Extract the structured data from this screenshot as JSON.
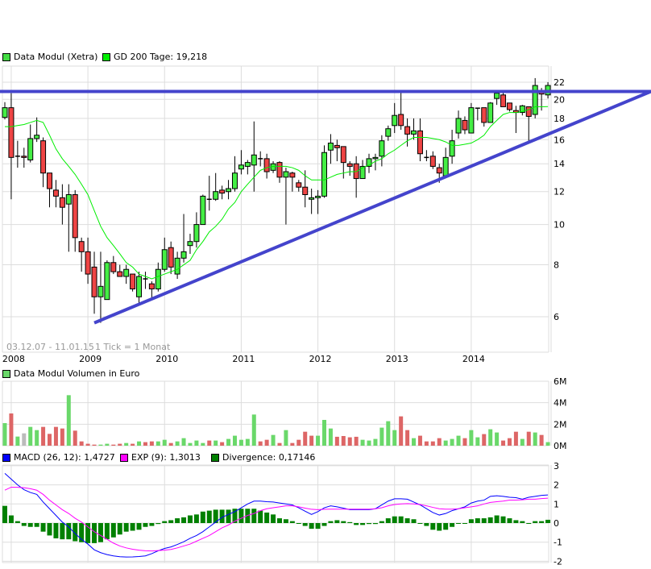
{
  "legend": {
    "price_series": "Data Modul (Xetra)",
    "ma_label": "GD 200 Tage: 19,218",
    "volume_label": "Data Modul Volumen in Euro",
    "macd_label": "MACD (26, 12): 1,4727",
    "signal_label": "EXP (9): 1,3013",
    "divergence_label": "Divergence: 0,17146"
  },
  "info": {
    "date_range": "03.12.07 - 11.01.15",
    "tick_info": "1 Tick = 1 Monat"
  },
  "colors": {
    "candle_up": "#44ee44",
    "candle_down": "#ee4444",
    "ma_line": "#00ee00",
    "trendline": "#4444cc",
    "volume_up": "#6ad86a",
    "volume_down": "#dd6666",
    "volume_flat": "#bbbbbb",
    "macd": "#0000ff",
    "signal": "#ff00ff",
    "divergence": "#008000",
    "grid": "#dddddd"
  },
  "chart_data": [
    {
      "type": "candlestick",
      "scale": "log",
      "ylim": [
        5.7,
        23
      ],
      "grid": true,
      "legend_placement": "top-left",
      "x_ticks": [
        "2008",
        "2009",
        "2010",
        "2011",
        "2012",
        "2013",
        "2014"
      ],
      "y_ticks": [
        6,
        8,
        10,
        12,
        14,
        16,
        18,
        20,
        22
      ],
      "columns": [
        "date",
        "open",
        "high",
        "low",
        "close"
      ],
      "candles": [
        [
          "2007-12",
          18.1,
          19.7,
          17.9,
          19.1
        ],
        [
          "2008-01",
          19.1,
          20.7,
          11.5,
          14.5
        ],
        [
          "2008-02",
          14.6,
          15.9,
          13.7,
          14.6
        ],
        [
          "2008-03",
          14.6,
          15.3,
          13.7,
          14.5
        ],
        [
          "2008-04",
          14.3,
          17.4,
          14.1,
          16.1
        ],
        [
          "2008-05",
          16.1,
          18.1,
          15.8,
          16.4
        ],
        [
          "2008-06",
          15.9,
          16.2,
          12.3,
          13.3
        ],
        [
          "2008-07",
          13.3,
          13.3,
          11.0,
          12.2
        ],
        [
          "2008-08",
          12.1,
          12.8,
          11.0,
          11.7
        ],
        [
          "2008-09",
          11.6,
          12.5,
          10.0,
          11.0
        ],
        [
          "2008-10",
          11.2,
          12.5,
          8.6,
          11.8
        ],
        [
          "2008-11",
          11.8,
          12.1,
          8.6,
          9.3
        ],
        [
          "2008-12",
          9.1,
          9.3,
          7.7,
          8.6
        ],
        [
          "2009-01",
          8.6,
          9.3,
          7.2,
          7.6
        ],
        [
          "2009-02",
          7.9,
          8.6,
          6.1,
          6.7
        ],
        [
          "2009-03",
          6.7,
          8.6,
          5.8,
          7.1
        ],
        [
          "2009-04",
          6.6,
          8.2,
          6.6,
          8.1
        ],
        [
          "2009-05",
          8.1,
          8.4,
          7.6,
          7.7
        ],
        [
          "2009-06",
          7.7,
          8.0,
          7.5,
          7.5
        ],
        [
          "2009-07",
          7.5,
          8.0,
          7.2,
          7.8
        ],
        [
          "2009-08",
          7.6,
          7.6,
          6.9,
          7.0
        ],
        [
          "2009-09",
          6.7,
          7.7,
          6.4,
          7.5
        ],
        [
          "2009-10",
          7.4,
          7.7,
          7.0,
          7.4
        ],
        [
          "2009-11",
          7.2,
          7.3,
          6.6,
          7.0
        ],
        [
          "2009-12",
          7.0,
          8.1,
          6.9,
          7.8
        ],
        [
          "2010-01",
          7.8,
          9.3,
          7.7,
          8.7
        ],
        [
          "2010-02",
          8.8,
          9.1,
          7.6,
          7.9
        ],
        [
          "2010-03",
          7.6,
          8.6,
          7.4,
          8.3
        ],
        [
          "2010-04",
          8.3,
          10.6,
          8.1,
          8.6
        ],
        [
          "2010-05",
          8.9,
          9.5,
          8.5,
          9.1
        ],
        [
          "2010-06",
          9.1,
          10.7,
          8.8,
          10.0
        ],
        [
          "2010-07",
          10.0,
          11.8,
          10.0,
          11.7
        ],
        [
          "2010-08",
          11.5,
          13.1,
          10.8,
          11.5
        ],
        [
          "2010-09",
          11.5,
          13.3,
          11.4,
          12.0
        ],
        [
          "2010-10",
          12.1,
          12.4,
          11.5,
          11.9
        ],
        [
          "2010-11",
          12.0,
          12.8,
          11.5,
          12.2
        ],
        [
          "2010-12",
          12.2,
          14.6,
          12.0,
          13.3
        ],
        [
          "2011-01",
          13.6,
          15.1,
          13.2,
          13.9
        ],
        [
          "2011-02",
          13.8,
          14.3,
          13.2,
          14.1
        ],
        [
          "2011-03",
          13.9,
          17.7,
          12.0,
          14.7
        ],
        [
          "2011-04",
          14.4,
          15.0,
          13.8,
          14.4
        ],
        [
          "2011-05",
          14.4,
          14.8,
          12.9,
          13.4
        ],
        [
          "2011-06",
          13.5,
          14.2,
          13.3,
          14.0
        ],
        [
          "2011-07",
          14.1,
          14.2,
          12.6,
          13.0
        ],
        [
          "2011-08",
          13.0,
          13.7,
          10.0,
          13.4
        ],
        [
          "2011-09",
          13.3,
          13.4,
          12.0,
          13.0
        ],
        [
          "2011-10",
          12.6,
          12.8,
          12.0,
          12.3
        ],
        [
          "2011-11",
          12.3,
          13.5,
          11.0,
          11.8
        ],
        [
          "2011-12",
          11.5,
          12.2,
          10.6,
          11.6
        ],
        [
          "2012-01",
          11.6,
          12.1,
          10.6,
          11.7
        ],
        [
          "2012-02",
          11.7,
          15.5,
          11.6,
          14.9
        ],
        [
          "2012-03",
          15.1,
          16.5,
          14.0,
          15.7
        ],
        [
          "2012-04",
          15.5,
          16.0,
          14.2,
          15.3
        ],
        [
          "2012-05",
          15.4,
          15.4,
          12.9,
          14.1
        ],
        [
          "2012-06",
          14.0,
          14.2,
          13.1,
          13.8
        ],
        [
          "2012-07",
          14.0,
          14.6,
          11.6,
          12.9
        ],
        [
          "2012-08",
          12.9,
          14.3,
          12.9,
          13.8
        ],
        [
          "2012-09",
          13.8,
          14.8,
          13.3,
          14.4
        ],
        [
          "2012-10",
          14.4,
          14.8,
          13.5,
          14.5
        ],
        [
          "2012-11",
          14.6,
          16.4,
          13.8,
          15.9
        ],
        [
          "2012-12",
          16.3,
          17.3,
          15.9,
          17.0
        ],
        [
          "2013-01",
          17.3,
          19.6,
          16.6,
          18.3
        ],
        [
          "2013-02",
          18.4,
          20.9,
          16.9,
          17.3
        ],
        [
          "2013-03",
          17.2,
          18.0,
          15.4,
          16.5
        ],
        [
          "2013-04",
          16.5,
          18.0,
          16.0,
          16.8
        ],
        [
          "2013-05",
          16.8,
          18.0,
          14.2,
          14.8
        ],
        [
          "2013-06",
          14.5,
          15.1,
          14.2,
          14.5
        ],
        [
          "2013-07",
          14.6,
          15.0,
          13.6,
          13.8
        ],
        [
          "2013-08",
          13.7,
          14.0,
          12.6,
          13.3
        ],
        [
          "2013-09",
          13.1,
          15.3,
          13.1,
          14.5
        ],
        [
          "2013-10",
          14.6,
          16.9,
          14.0,
          15.9
        ],
        [
          "2013-11",
          16.6,
          18.8,
          16.1,
          18.0
        ],
        [
          "2013-12",
          17.8,
          18.2,
          16.5,
          16.9
        ],
        [
          "2014-01",
          16.6,
          19.6,
          16.6,
          19.1
        ],
        [
          "2014-02",
          19.1,
          19.1,
          17.8,
          19.0
        ],
        [
          "2014-03",
          19.1,
          19.1,
          17.2,
          17.6
        ],
        [
          "2014-04",
          17.6,
          19.7,
          17.6,
          19.6
        ],
        [
          "2014-05",
          20.1,
          21.0,
          19.4,
          20.7
        ],
        [
          "2014-06",
          20.5,
          20.8,
          19.2,
          19.2
        ],
        [
          "2014-07",
          19.6,
          19.6,
          18.7,
          18.9
        ],
        [
          "2014-08",
          18.8,
          19.3,
          16.6,
          18.6
        ],
        [
          "2014-09",
          18.6,
          19.4,
          18.3,
          19.3
        ],
        [
          "2014-10",
          19.2,
          19.2,
          15.8,
          18.2
        ],
        [
          "2014-11",
          18.4,
          22.5,
          18.0,
          21.6
        ],
        [
          "2014-12",
          20.9,
          21.3,
          18.8,
          20.6
        ],
        [
          "2015-01",
          20.5,
          22.0,
          20.1,
          21.6
        ]
      ],
      "moving_average": {
        "name": "GD 200 Tage",
        "values": [
          17.2,
          17.2,
          17.3,
          17.4,
          17.6,
          17.8,
          17.6,
          16.4,
          15.2,
          14.4,
          13.8,
          13.2,
          12.5,
          11.8,
          10.8,
          9.9,
          9.3,
          8.9,
          8.5,
          8.1,
          7.9,
          7.6,
          7.5,
          7.4,
          7.5,
          7.6,
          7.7,
          7.8,
          8.0,
          8.2,
          8.7,
          9.1,
          9.6,
          9.9,
          10.3,
          10.9,
          11.3,
          12.0,
          12.5,
          13.0,
          13.5,
          13.7,
          13.8,
          13.8,
          13.8,
          13.7,
          13.5,
          13.1,
          12.8,
          12.8,
          12.8,
          13.0,
          13.2,
          13.3,
          13.4,
          13.4,
          13.7,
          13.9,
          14.2,
          14.4,
          14.8,
          15.1,
          15.5,
          15.9,
          16.2,
          16.2,
          16.2,
          16.1,
          16.0,
          15.8,
          15.5,
          15.5,
          15.6,
          15.7,
          16.0,
          16.4,
          17.2,
          17.8,
          18.4,
          18.6,
          18.6,
          18.7,
          18.9,
          19.2,
          19.2,
          19.218
        ]
      },
      "trendlines": [
        {
          "kind": "resistance",
          "from": [
            "2007-11",
            20.9
          ],
          "to": [
            "2016-05",
            20.9
          ]
        },
        {
          "kind": "support",
          "from": [
            "2009-02",
            5.8
          ],
          "to": [
            "2016-05",
            20.9
          ]
        }
      ]
    },
    {
      "type": "bar",
      "ylabel": "",
      "ylim": [
        0,
        6
      ],
      "y_ticks": [
        "0M",
        "2M",
        "4M",
        "6M"
      ],
      "unit": "M",
      "values": [
        2.1,
        3.0,
        0.85,
        1.15,
        1.75,
        1.45,
        1.75,
        1.1,
        1.75,
        1.6,
        4.7,
        1.4,
        0.4,
        0.18,
        0.1,
        0.1,
        0.18,
        0.1,
        0.18,
        0.25,
        0.18,
        0.4,
        0.33,
        0.4,
        0.4,
        0.55,
        0.25,
        0.4,
        0.7,
        0.25,
        0.48,
        0.25,
        0.48,
        0.48,
        0.33,
        0.63,
        0.93,
        0.55,
        0.63,
        2.9,
        0.4,
        0.55,
        1.0,
        0.25,
        1.45,
        0.25,
        0.55,
        1.3,
        0.93,
        0.93,
        2.4,
        1.6,
        0.83,
        0.9,
        0.78,
        0.83,
        0.55,
        0.48,
        0.63,
        1.68,
        2.28,
        1.45,
        2.73,
        1.45,
        0.7,
        0.93,
        0.4,
        0.4,
        0.7,
        0.48,
        0.63,
        0.93,
        0.7,
        1.45,
        0.78,
        1.08,
        1.53,
        1.23,
        0.48,
        0.7,
        1.3,
        0.63,
        1.3,
        1.23,
        1.0,
        0.33
      ],
      "direction": [
        "up",
        "down",
        "up",
        "flat",
        "up",
        "up",
        "down",
        "down",
        "down",
        "down",
        "up",
        "down",
        "down",
        "down",
        "down",
        "up",
        "up",
        "down",
        "down",
        "up",
        "down",
        "up",
        "down",
        "down",
        "up",
        "up",
        "down",
        "up",
        "up",
        "up",
        "up",
        "up",
        "down",
        "up",
        "down",
        "up",
        "up",
        "up",
        "up",
        "up",
        "down",
        "down",
        "up",
        "down",
        "up",
        "down",
        "down",
        "down",
        "down",
        "up",
        "up",
        "up",
        "down",
        "down",
        "down",
        "down",
        "up",
        "up",
        "up",
        "up",
        "up",
        "up",
        "down",
        "down",
        "up",
        "down",
        "down",
        "down",
        "down",
        "up",
        "up",
        "up",
        "down",
        "up",
        "up",
        "down",
        "up",
        "up",
        "down",
        "down",
        "down",
        "up",
        "down",
        "up",
        "down",
        "up"
      ]
    },
    {
      "type": "line",
      "ylim": [
        -2,
        3
      ],
      "y_ticks": [
        3,
        2,
        1,
        0,
        -1,
        -2
      ],
      "series": [
        {
          "name": "MACD (26, 12)",
          "values": [
            2.6,
            2.3,
            2.0,
            1.75,
            1.6,
            1.5,
            1.1,
            0.75,
            0.4,
            0.05,
            -0.2,
            -0.55,
            -0.85,
            -1.1,
            -1.4,
            -1.55,
            -1.65,
            -1.72,
            -1.76,
            -1.78,
            -1.77,
            -1.75,
            -1.72,
            -1.6,
            -1.45,
            -1.33,
            -1.25,
            -1.12,
            -0.98,
            -0.8,
            -0.65,
            -0.45,
            -0.2,
            0.05,
            0.3,
            0.45,
            0.6,
            0.8,
            1.0,
            1.15,
            1.15,
            1.12,
            1.1,
            1.05,
            1.0,
            0.95,
            0.8,
            0.62,
            0.45,
            0.6,
            0.8,
            0.9,
            0.85,
            0.78,
            0.7,
            0.7,
            0.7,
            0.7,
            0.75,
            0.95,
            1.15,
            1.27,
            1.27,
            1.25,
            1.1,
            0.95,
            0.75,
            0.55,
            0.42,
            0.5,
            0.65,
            0.75,
            0.85,
            1.05,
            1.15,
            1.2,
            1.4,
            1.43,
            1.4,
            1.35,
            1.33,
            1.25,
            1.35,
            1.4,
            1.45,
            1.4727
          ]
        },
        {
          "name": "EXP (9)",
          "values": [
            1.72,
            1.88,
            1.87,
            1.85,
            1.8,
            1.72,
            1.5,
            1.2,
            0.95,
            0.7,
            0.5,
            0.25,
            0.05,
            -0.2,
            -0.45,
            -0.65,
            -0.85,
            -1.05,
            -1.2,
            -1.3,
            -1.37,
            -1.42,
            -1.45,
            -1.46,
            -1.44,
            -1.42,
            -1.38,
            -1.3,
            -1.2,
            -1.1,
            -0.95,
            -0.8,
            -0.65,
            -0.45,
            -0.25,
            -0.1,
            0.1,
            0.25,
            0.4,
            0.5,
            0.65,
            0.75,
            0.8,
            0.85,
            0.9,
            0.9,
            0.85,
            0.78,
            0.72,
            0.7,
            0.72,
            0.73,
            0.73,
            0.73,
            0.73,
            0.73,
            0.73,
            0.73,
            0.75,
            0.8,
            0.9,
            0.97,
            1.0,
            1.02,
            1.0,
            0.97,
            0.9,
            0.82,
            0.75,
            0.73,
            0.73,
            0.75,
            0.8,
            0.85,
            0.9,
            1.0,
            1.08,
            1.12,
            1.15,
            1.2,
            1.2,
            1.22,
            1.25,
            1.25,
            1.28,
            1.3013
          ]
        },
        {
          "name": "Divergence",
          "kind": "bar",
          "values": [
            0.9,
            0.4,
            0.1,
            -0.15,
            -0.2,
            -0.2,
            -0.45,
            -0.65,
            -0.8,
            -0.85,
            -0.85,
            -0.95,
            -1.0,
            -1.05,
            -1.05,
            -1.0,
            -0.85,
            -0.75,
            -0.6,
            -0.45,
            -0.4,
            -0.35,
            -0.2,
            -0.15,
            -0.05,
            0.1,
            0.15,
            0.25,
            0.3,
            0.4,
            0.45,
            0.6,
            0.65,
            0.7,
            0.7,
            0.7,
            0.75,
            0.75,
            0.75,
            0.75,
            0.65,
            0.55,
            0.45,
            0.25,
            0.2,
            0.1,
            -0.03,
            -0.15,
            -0.3,
            -0.3,
            -0.15,
            0.1,
            0.15,
            0.1,
            0.05,
            -0.1,
            -0.1,
            -0.05,
            -0.05,
            0.1,
            0.25,
            0.35,
            0.35,
            0.25,
            0.2,
            0.0,
            -0.15,
            -0.35,
            -0.4,
            -0.35,
            -0.2,
            -0.03,
            -0.03,
            0.2,
            0.25,
            0.25,
            0.3,
            0.4,
            0.35,
            0.25,
            0.15,
            0.1,
            0.0,
            0.1,
            0.1,
            0.17146
          ]
        }
      ]
    }
  ]
}
